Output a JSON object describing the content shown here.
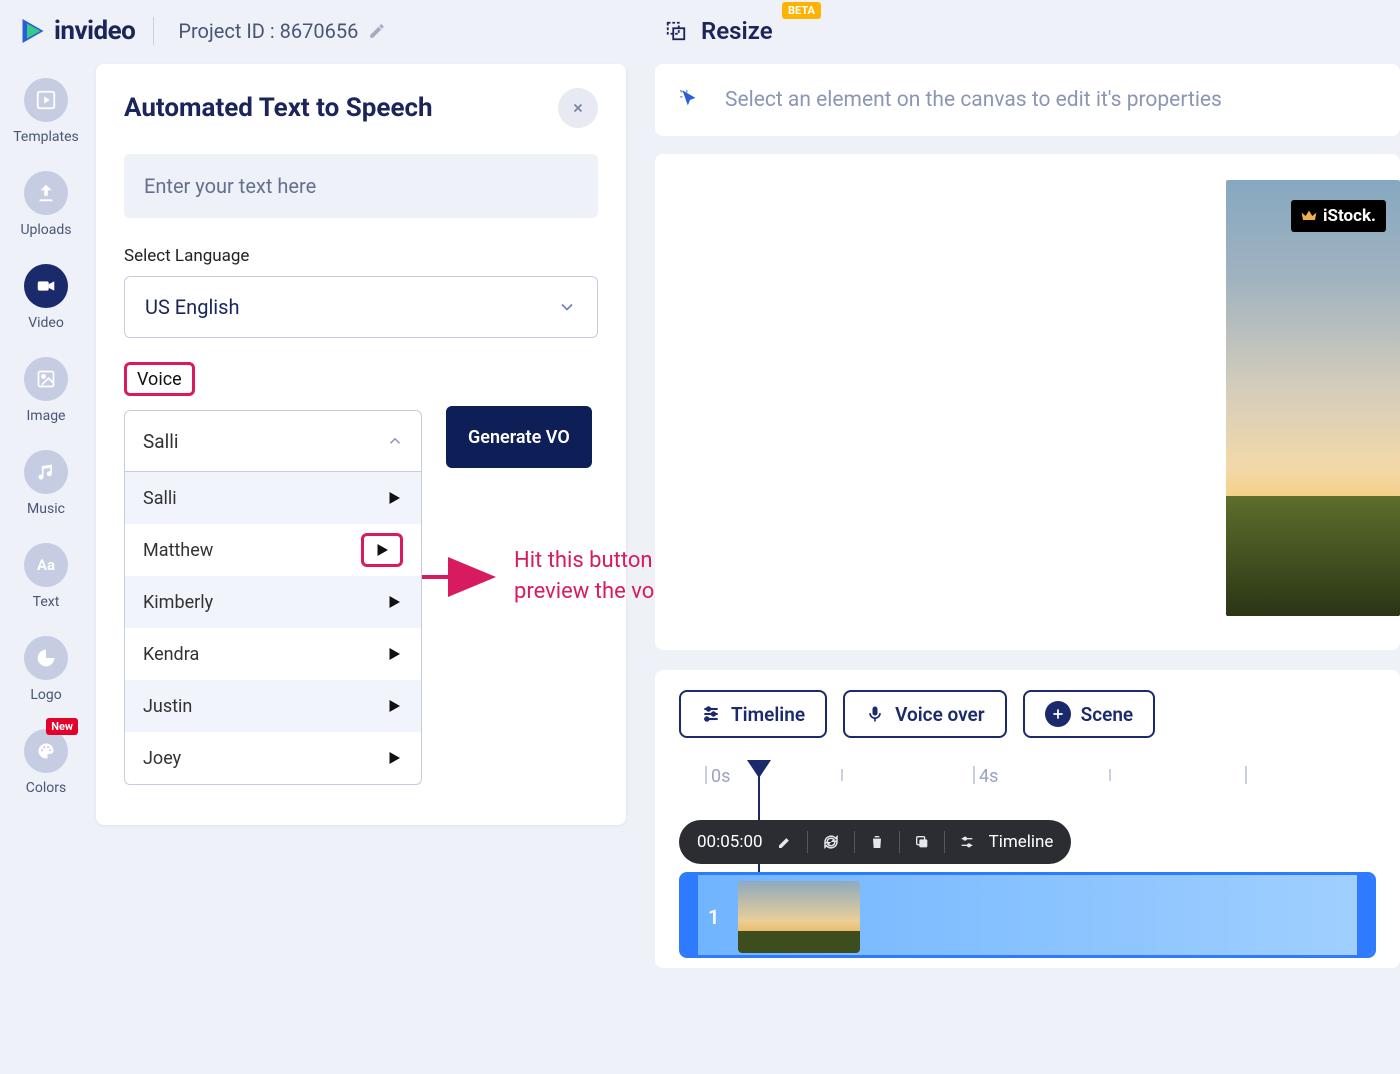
{
  "brand": {
    "name": "invideo"
  },
  "project": {
    "label": "Project ID : 8670656"
  },
  "resize": {
    "label": "Resize",
    "beta": "BETA"
  },
  "nav": [
    {
      "key": "templates",
      "label": "Templates"
    },
    {
      "key": "uploads",
      "label": "Uploads"
    },
    {
      "key": "video",
      "label": "Video"
    },
    {
      "key": "image",
      "label": "Image"
    },
    {
      "key": "music",
      "label": "Music"
    },
    {
      "key": "text",
      "label": "Text"
    },
    {
      "key": "logo",
      "label": "Logo"
    },
    {
      "key": "colors",
      "label": "Colors",
      "badge": "New"
    }
  ],
  "tts": {
    "title": "Automated Text to Speech",
    "placeholder": "Enter your text here",
    "lang_label": "Select Language",
    "lang_value": "US English",
    "voice_label": "Voice",
    "voice_selected": "Salli",
    "voices": [
      "Salli",
      "Matthew",
      "Kimberly",
      "Kendra",
      "Justin",
      "Joey"
    ],
    "generate": "Generate VO"
  },
  "annotation": {
    "text1": "Hit this button to",
    "text2": "preview the voice"
  },
  "hint": {
    "text": "Select an element on the canvas to edit it's properties"
  },
  "istock": "iStock.",
  "bot_tabs": {
    "timeline": "Timeline",
    "voiceover": "Voice over",
    "scene": "Scene"
  },
  "ruler": {
    "t0": "0s",
    "t4": "4s"
  },
  "clipbar": {
    "time": "00:05:00",
    "label": "Timeline",
    "count": "1"
  }
}
